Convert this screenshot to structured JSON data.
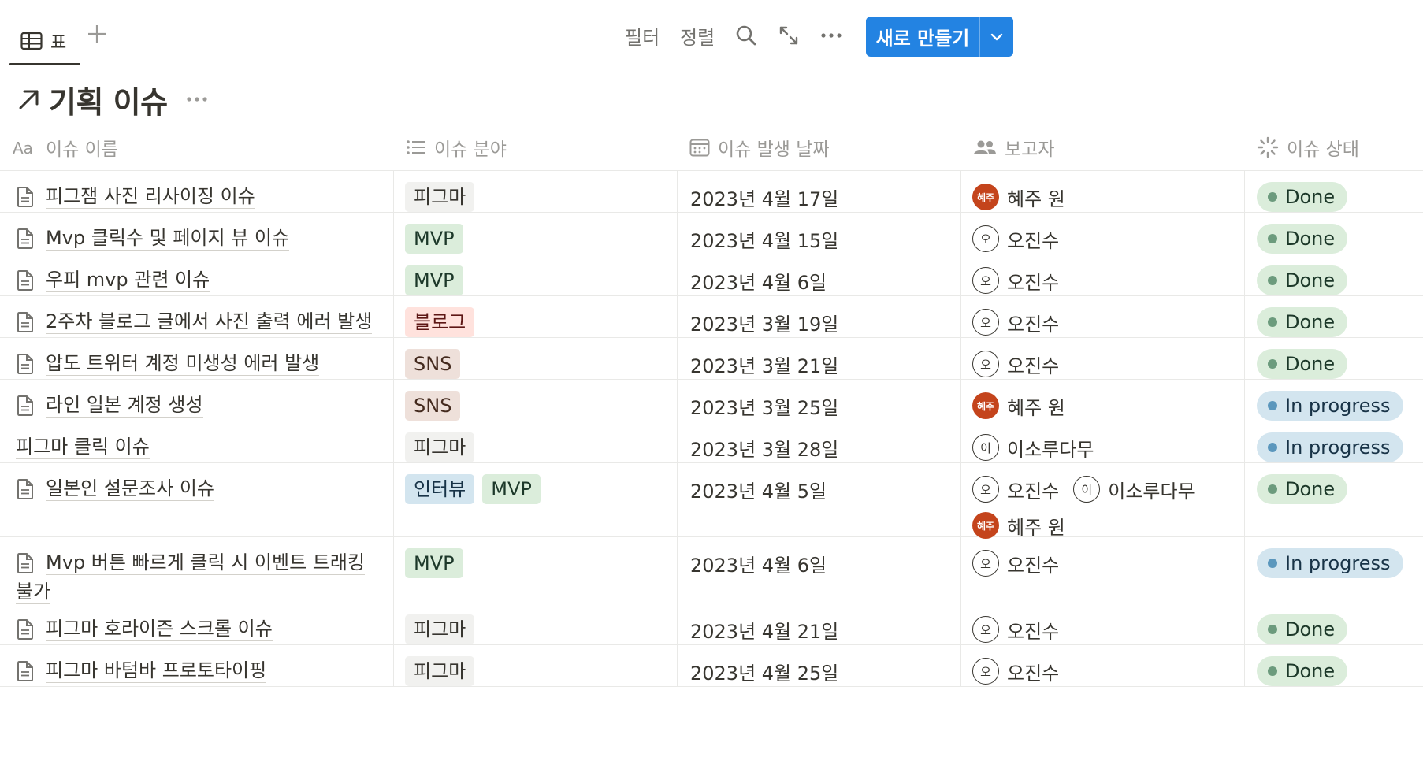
{
  "toolbar": {
    "view_tab_label": "표",
    "filter_label": "필터",
    "sort_label": "정렬",
    "new_button_label": "새로 만들기",
    "icons": [
      "table-icon",
      "plus-icon",
      "search-icon",
      "expand-icon",
      "more-icon",
      "chevron-down-icon"
    ]
  },
  "database": {
    "title": "기획 이슈",
    "title_icon": "arrow-up-right-icon"
  },
  "columns": [
    {
      "label": "이슈 이름",
      "icon": "text-type-icon"
    },
    {
      "label": "이슈 분야",
      "icon": "list-icon"
    },
    {
      "label": "이슈 발생 날짜",
      "icon": "calendar-icon"
    },
    {
      "label": "보고자",
      "icon": "people-icon"
    },
    {
      "label": "이슈 상태",
      "icon": "status-icon"
    }
  ],
  "tag_colors": {
    "피그마": {
      "bg": "#f1f1ef",
      "fg": "#37352f"
    },
    "MVP": {
      "bg": "#dbeddb",
      "fg": "#1c3829"
    },
    "블로그": {
      "bg": "#ffe2dd",
      "fg": "#5d1715"
    },
    "SNS": {
      "bg": "#eee0da",
      "fg": "#442a1e"
    },
    "인터뷰": {
      "bg": "#d3e5ef",
      "fg": "#183347"
    }
  },
  "status_colors": {
    "Done": {
      "bg": "#dbeddb",
      "fg": "#1c3829",
      "dot": "#6c9b7d"
    },
    "In progress": {
      "bg": "#d3e5ef",
      "fg": "#183347",
      "dot": "#5b97bd"
    }
  },
  "rows": [
    {
      "name": "피그잼 사진 리사이징 이슈",
      "has_doc_icon": true,
      "tags": [
        "피그마"
      ],
      "date": "2023년 4월 17일",
      "reporters": [
        {
          "name": "혜주 원",
          "initials": "혜주",
          "filled": true
        }
      ],
      "status": "Done"
    },
    {
      "name": "Mvp 클릭수 및 페이지 뷰 이슈",
      "has_doc_icon": true,
      "tags": [
        "MVP"
      ],
      "date": "2023년 4월 15일",
      "reporters": [
        {
          "name": "오진수",
          "initials": "오",
          "filled": false
        }
      ],
      "status": "Done"
    },
    {
      "name": "우피 mvp 관련 이슈",
      "has_doc_icon": true,
      "tags": [
        "MVP"
      ],
      "date": "2023년 4월 6일",
      "reporters": [
        {
          "name": "오진수",
          "initials": "오",
          "filled": false
        }
      ],
      "status": "Done"
    },
    {
      "name": "2주차 블로그 글에서 사진 출력 에러 발생",
      "has_doc_icon": true,
      "tags": [
        "블로그"
      ],
      "date": "2023년 3월 19일",
      "reporters": [
        {
          "name": "오진수",
          "initials": "오",
          "filled": false
        }
      ],
      "status": "Done"
    },
    {
      "name": "압도 트위터 계정 미생성 에러 발생",
      "has_doc_icon": true,
      "tags": [
        "SNS"
      ],
      "date": "2023년 3월 21일",
      "reporters": [
        {
          "name": "오진수",
          "initials": "오",
          "filled": false
        }
      ],
      "status": "Done"
    },
    {
      "name": "라인 일본 계정 생성",
      "has_doc_icon": true,
      "tags": [
        "SNS"
      ],
      "date": "2023년 3월 25일",
      "reporters": [
        {
          "name": "혜주 원",
          "initials": "혜주",
          "filled": true
        }
      ],
      "status": "In progress"
    },
    {
      "name": "피그마 클릭 이슈",
      "has_doc_icon": false,
      "tags": [
        "피그마"
      ],
      "date": "2023년 3월 28일",
      "reporters": [
        {
          "name": "이소루다무",
          "initials": "이",
          "filled": false
        }
      ],
      "status": "In progress"
    },
    {
      "name": "일본인 설문조사 이슈",
      "has_doc_icon": true,
      "tags": [
        "인터뷰",
        "MVP"
      ],
      "date": "2023년 4월 5일",
      "reporters": [
        {
          "name": "오진수",
          "initials": "오",
          "filled": false
        },
        {
          "name": "이소루다무",
          "initials": "이",
          "filled": false
        },
        {
          "name": "혜주 원",
          "initials": "혜주",
          "filled": true
        }
      ],
      "status": "Done"
    },
    {
      "name": "Mvp 버튼 빠르게 클릭 시 이벤트 트래킹 불가",
      "has_doc_icon": true,
      "tags": [
        "MVP"
      ],
      "date": "2023년 4월 6일",
      "reporters": [
        {
          "name": "오진수",
          "initials": "오",
          "filled": false
        }
      ],
      "status": "In progress"
    },
    {
      "name": "피그마 호라이즌 스크롤 이슈",
      "has_doc_icon": true,
      "tags": [
        "피그마"
      ],
      "date": "2023년 4월 21일",
      "reporters": [
        {
          "name": "오진수",
          "initials": "오",
          "filled": false
        }
      ],
      "status": "Done"
    },
    {
      "name": "피그마 바텀바 프로토타이핑",
      "has_doc_icon": true,
      "tags": [
        "피그마"
      ],
      "date": "2023년 4월 25일",
      "reporters": [
        {
          "name": "오진수",
          "initials": "오",
          "filled": false
        }
      ],
      "status": "Done"
    }
  ]
}
